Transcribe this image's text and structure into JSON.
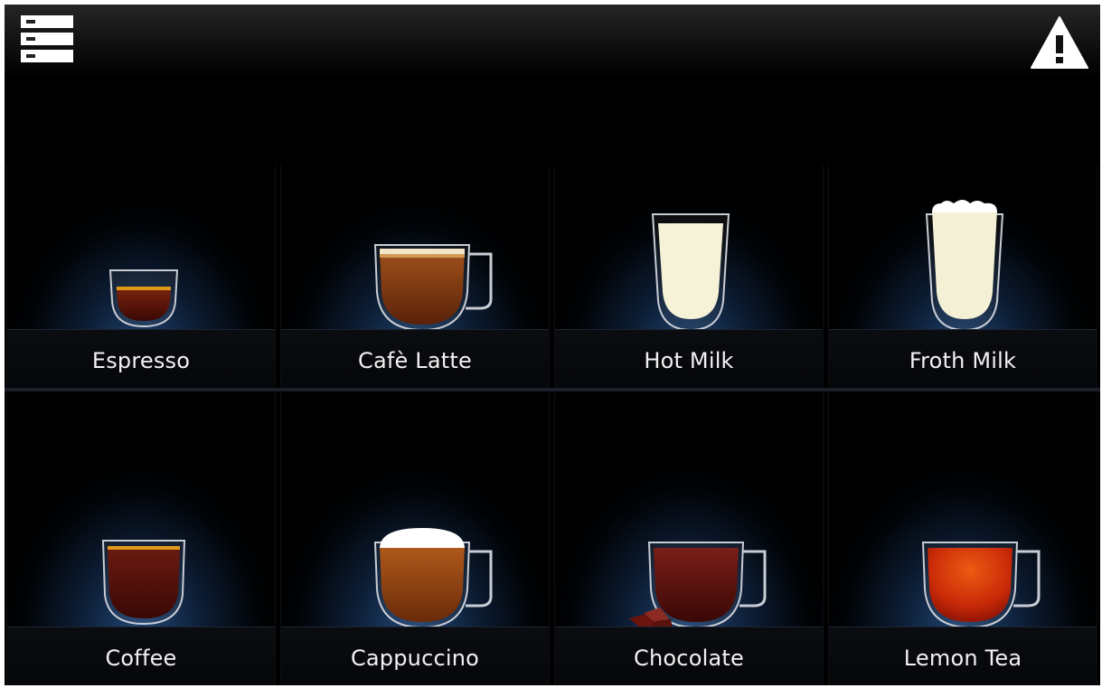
{
  "app": {
    "topbar": {
      "menu_icon": "menu-list-icon",
      "alert_icon": "warning-triangle-icon"
    },
    "drinks": [
      {
        "label": "Espresso",
        "icon": "espresso-cup-icon",
        "liquid_color": "#5a1208"
      },
      {
        "label": "Cafè Latte",
        "icon": "latte-mug-icon",
        "liquid_color": "#7a3a12"
      },
      {
        "label": "Hot Milk",
        "icon": "hot-milk-glass-icon",
        "liquid_color": "#f7f3dc"
      },
      {
        "label": "Froth Milk",
        "icon": "froth-milk-glass-icon",
        "liquid_color": "#f4f0d6"
      },
      {
        "label": "Coffee",
        "icon": "coffee-cup-icon",
        "liquid_color": "#4a0f0a"
      },
      {
        "label": "Cappuccino",
        "icon": "cappuccino-mug-icon",
        "liquid_color": "#8a4216"
      },
      {
        "label": "Chocolate",
        "icon": "chocolate-mug-icon",
        "liquid_color": "#5a1510"
      },
      {
        "label": "Lemon Tea",
        "icon": "lemon-tea-mug-icon",
        "liquid_color": "#c82a08"
      }
    ]
  }
}
